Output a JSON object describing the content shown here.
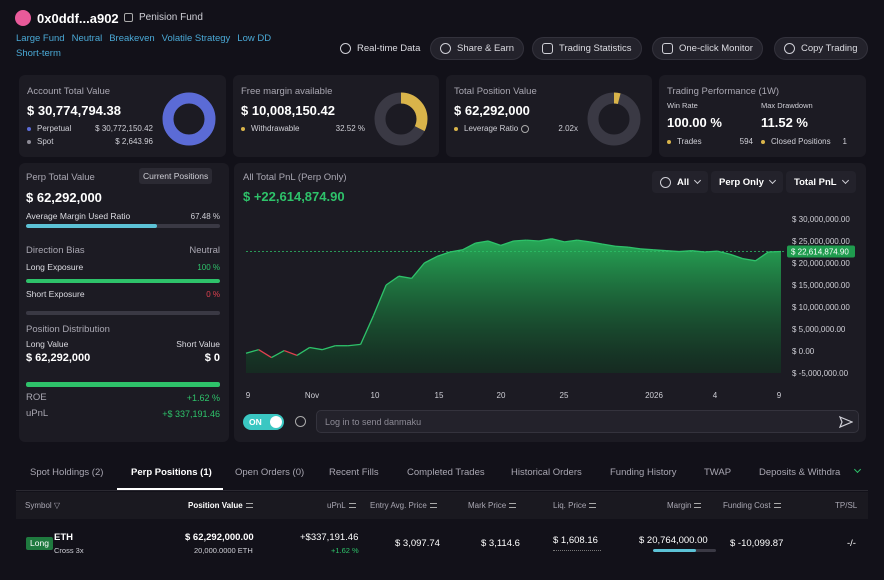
{
  "header": {
    "address": "0x0ddf...a902",
    "fund_name": "Penision Fund",
    "tags": [
      "Large Fund",
      "Neutral",
      "Breakeven",
      "Volatile Strategy",
      "Low DD",
      "Short-term"
    ],
    "buttons": {
      "realtime": "Real-time Data",
      "share": "Share & Earn",
      "stats": "Trading Statistics",
      "monitor": "One-click Monitor",
      "copy": "Copy Trading"
    }
  },
  "account": {
    "title": "Account Total Value",
    "value": "$ 30,774,794.38",
    "rows": [
      {
        "label": "Perpetual",
        "value": "$ 30,772,150.42"
      },
      {
        "label": "Spot",
        "value": "$ 2,643.96"
      }
    ],
    "donut_fraction": 0.9999,
    "color": "#5b6bd6"
  },
  "margin": {
    "title": "Free margin available",
    "value": "$ 10,008,150.42",
    "row_label": "Withdrawable",
    "row_value": "32.52 %",
    "donut_fraction": 0.3252,
    "color": "#d9b44a"
  },
  "position": {
    "title": "Total Position Value",
    "value": "$ 62,292,000",
    "row_label": "Leverage Ratio",
    "row_value": "2.02x",
    "donut_fraction": 0.04,
    "color": "#d9b44a"
  },
  "performance": {
    "title": "Trading Performance (1W)",
    "win_rate_label": "Win Rate",
    "win_rate": "100.00 %",
    "drawdown_label": "Max Drawdown",
    "drawdown": "11.52 %",
    "trades_label": "Trades",
    "trades": "594",
    "closed_label": "Closed Positions",
    "closed": "1"
  },
  "perp": {
    "title": "Perp Total Value",
    "current_btn": "Current Positions",
    "value": "$ 62,292,000",
    "margin_label": "Average Margin Used Ratio",
    "margin_value": "67.48 %",
    "margin_fraction": 0.6748,
    "bias_label": "Direction Bias",
    "bias_value": "Neutral",
    "long_label": "Long Exposure",
    "long_value": "100 %",
    "long_fraction": 1.0,
    "short_label": "Short Exposure",
    "short_value": "0 %",
    "short_fraction": 0,
    "dist_label": "Position Distribution",
    "long_value_label": "Long Value",
    "short_value_label": "Short Value",
    "long_val": "$ 62,292,000",
    "short_val": "$ 0",
    "roe_label": "ROE",
    "roe": "+1.62 %",
    "upnl_label": "uPnL",
    "upnl": "+$ 337,191.46"
  },
  "chart_panel": {
    "title": "All Total PnL (Perp Only)",
    "value": "$ +22,614,874.90",
    "dd_all": "All",
    "dd_perp": "Perp Only",
    "dd_pnl": "Total PnL",
    "toggle": "ON",
    "danmaku_placeholder": "Log in to send danmaku",
    "current_label": "$ 22,614,874.90"
  },
  "chart_data": {
    "type": "area",
    "xlabel": "",
    "ylabel": "",
    "x_ticks": [
      "9",
      "Nov",
      "10",
      "15",
      "20",
      "25",
      "2026",
      "4",
      "9"
    ],
    "y_ticks": [
      "$ 30,000,000.00",
      "$ 25,000,000.00",
      "$ 20,000,000.00",
      "$ 15,000,000.00",
      "$ 10,000,000.00",
      "$ 5,000,000.00",
      "$ 0.00",
      "$ -5,000,000.00"
    ],
    "ylim": [
      -5000000,
      30000000
    ],
    "current_value": 22614874.9,
    "values": [
      -500000,
      300000,
      -1500000,
      100000,
      -1000000,
      800000,
      300000,
      1200000,
      1200000,
      1500000,
      8000000,
      15000000,
      17000000,
      16500000,
      20000000,
      21500000,
      22500000,
      23000000,
      24500000,
      25000000,
      24000000,
      25000000,
      25200000,
      25000000,
      25500000,
      24800000,
      25200000,
      24800000,
      24300000,
      23800000,
      23600000,
      23200000,
      23000000,
      22800000,
      22600000,
      22800000,
      22500000,
      22700000,
      22000000,
      21000000,
      20500000,
      22500000,
      22614874.9
    ]
  },
  "tabs": [
    "Spot Holdings (2)",
    "Perp Positions (1)",
    "Open Orders (0)",
    "Recent Fills",
    "Completed Trades",
    "Historical Orders",
    "Funding History",
    "TWAP",
    "Deposits & Withdra"
  ],
  "table": {
    "headers": {
      "symbol": "Symbol",
      "position_value": "Position Value",
      "upnl": "uPnL",
      "entry": "Entry Avg. Price",
      "mark": "Mark Price",
      "liq": "Liq. Price",
      "margin": "Margin",
      "funding": "Funding Cost",
      "tpsl": "TP/SL"
    },
    "row": {
      "side": "Long",
      "symbol": "ETH",
      "mode": "Cross 3x",
      "position_value": "$ 62,292,000.00",
      "position_size": "20,000.0000 ETH",
      "upnl": "+$337,191.46",
      "upnl_pct": "+1.62 %",
      "entry": "$ 3,097.74",
      "mark": "$ 3,114.6",
      "liq": "$ 1,608.16",
      "margin": "$ 20,764,000.00",
      "margin_fraction": 0.6748,
      "funding": "$ -10,099.87",
      "tpsl": "-/-"
    }
  }
}
